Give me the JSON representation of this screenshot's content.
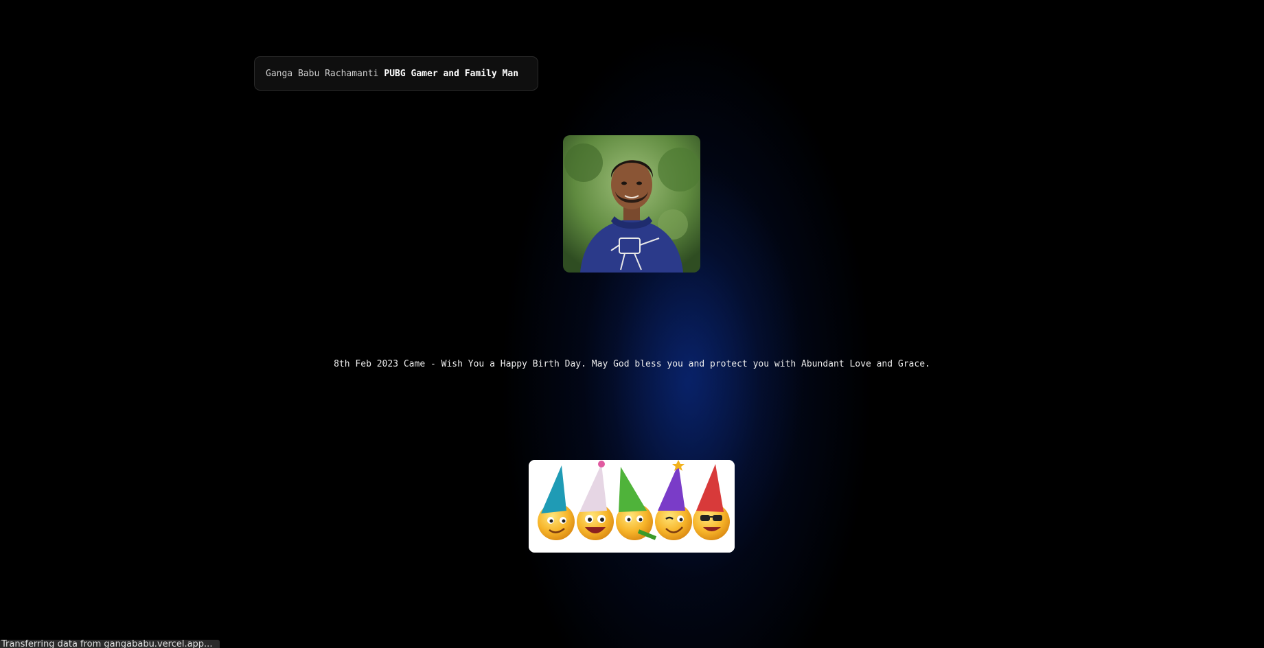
{
  "header": {
    "name": "Ganga Babu Rachamanti",
    "role": "PUBG Gamer and Family Man"
  },
  "profile": {
    "photo": "profile-photo"
  },
  "message": {
    "text": "8th Feb 2023 Came - Wish You a Happy Birth Day. May God bless you and protect you with Abundant Love and Grace."
  },
  "party_image": {
    "description": "party-emojis"
  },
  "status_bar": {
    "text": "Transferring data from gangababu.vercel.app..."
  },
  "colors": {
    "background": "#000000",
    "glow": "#0a2d8c",
    "text": "#e8e8e8"
  }
}
